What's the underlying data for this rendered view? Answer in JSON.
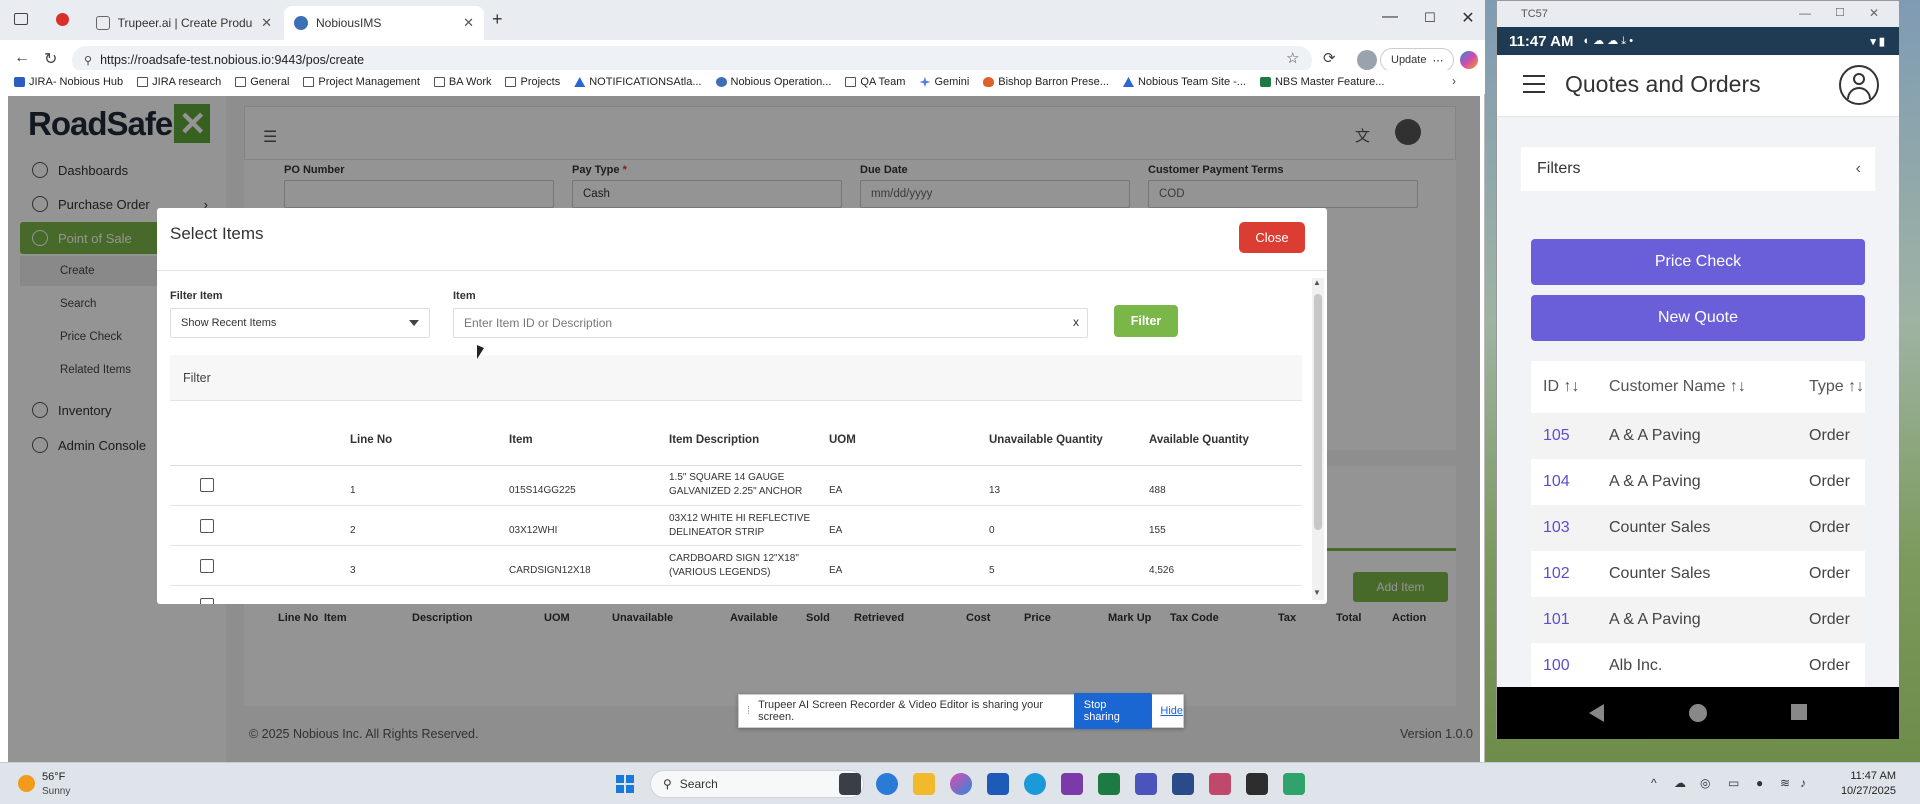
{
  "browser": {
    "tabs": [
      {
        "label": "Trupeer.ai | Create Product Video"
      },
      {
        "label": "NobiousIMS"
      }
    ],
    "url": "https://roadsafe-test.nobious.io:9443/pos/create",
    "update_label": "Update",
    "bookmarks": [
      "JIRA- Nobious Hub",
      "JIRA research",
      "General",
      "Project Management",
      "BA Work",
      "Projects",
      "NOTIFICATIONSAtla...",
      "Nobious Operation...",
      "QA Team",
      "Gemini",
      "Bishop Barron Prese...",
      "Nobious Team Site -...",
      "NBS Master Feature..."
    ]
  },
  "app": {
    "logo_text": "RoadSafe",
    "nav": [
      {
        "label": "Dashboards",
        "icon": "dashboard-icon"
      },
      {
        "label": "Purchase Order",
        "icon": "cart-icon"
      },
      {
        "label": "Point of Sale",
        "icon": "cart-icon"
      },
      {
        "label": "Inventory",
        "icon": "box-icon"
      },
      {
        "label": "Admin Console",
        "icon": "gear-icon"
      }
    ],
    "pos_subnav": [
      "Create",
      "Search",
      "Price Check",
      "Related Items"
    ],
    "form": {
      "po_number_label": "PO Number",
      "pay_type_label": "Pay Type",
      "pay_type_value": "Cash",
      "due_date_label": "Due Date",
      "due_date_placeholder": "mm/dd/yyyy",
      "payment_terms_label": "Customer Payment Terms",
      "payment_terms_value": "COD"
    },
    "add_item_label": "Add Item",
    "lines_headers": [
      "Line No",
      "Item",
      "Description",
      "UOM",
      "Unavailable",
      "Available",
      "Sold",
      "Retrieved",
      "Cost",
      "Price",
      "Mark Up",
      "Tax Code",
      "Tax",
      "Total",
      "Action"
    ],
    "footer_copyright": "© 2025 Nobious Inc. All Rights Reserved.",
    "footer_version": "Version 1.0.0"
  },
  "modal": {
    "title": "Select Items",
    "close_label": "Close",
    "filter_item_label": "Filter Item",
    "filter_item_value": "Show Recent Items",
    "item_label": "Item",
    "item_placeholder": "Enter Item ID or Description",
    "clear_label": "x",
    "filter_button": "Filter",
    "filter_panel_label": "Filter",
    "columns": [
      "Line No",
      "Item",
      "Item Description",
      "UOM",
      "Unavailable Quantity",
      "Available Quantity"
    ],
    "rows": [
      {
        "line": "1",
        "item": "015S14GG225",
        "desc1": "1.5\" SQUARE 14 GAUGE",
        "desc2": "GALVANIZED 2.25\" ANCHOR",
        "uom": "EA",
        "unavail": "13",
        "avail": "488"
      },
      {
        "line": "2",
        "item": "03X12WHI",
        "desc1": "03X12 WHITE HI REFLECTIVE",
        "desc2": "DELINEATOR STRIP",
        "uom": "EA",
        "unavail": "0",
        "avail": "155"
      },
      {
        "line": "3",
        "item": "CARDSIGN12X18",
        "desc1": "CARDBOARD SIGN 12\"X18\"",
        "desc2": "(VARIOUS LEGENDS)",
        "uom": "EA",
        "unavail": "5",
        "avail": "4,526"
      }
    ]
  },
  "share_bar": {
    "text": "Trupeer AI Screen Recorder & Video Editor is sharing your screen.",
    "stop_label": "Stop sharing",
    "hide_label": "Hide"
  },
  "phone": {
    "window_title": "TC57",
    "status_time": "11:47 AM",
    "title": "Quotes and Orders",
    "filters_label": "Filters",
    "price_check_label": "Price Check",
    "new_quote_label": "New Quote",
    "accent_color": "#6a5fd9",
    "headers": {
      "id": "ID ↑↓",
      "customer": "Customer Name ↑↓",
      "type": "Type ↑↓"
    },
    "rows": [
      {
        "id": "105",
        "customer": "A & A Paving",
        "type": "Order"
      },
      {
        "id": "104",
        "customer": "A & A Paving",
        "type": "Order"
      },
      {
        "id": "103",
        "customer": "Counter Sales",
        "type": "Order"
      },
      {
        "id": "102",
        "customer": "Counter Sales",
        "type": "Order"
      },
      {
        "id": "101",
        "customer": "A & A Paving",
        "type": "Order"
      },
      {
        "id": "100",
        "customer": "Alb Inc.",
        "type": "Order"
      }
    ]
  },
  "taskbar": {
    "temperature": "56°F",
    "weather": "Sunny",
    "search_label": "Search",
    "time": "11:47 AM",
    "date": "10/27/2025"
  }
}
